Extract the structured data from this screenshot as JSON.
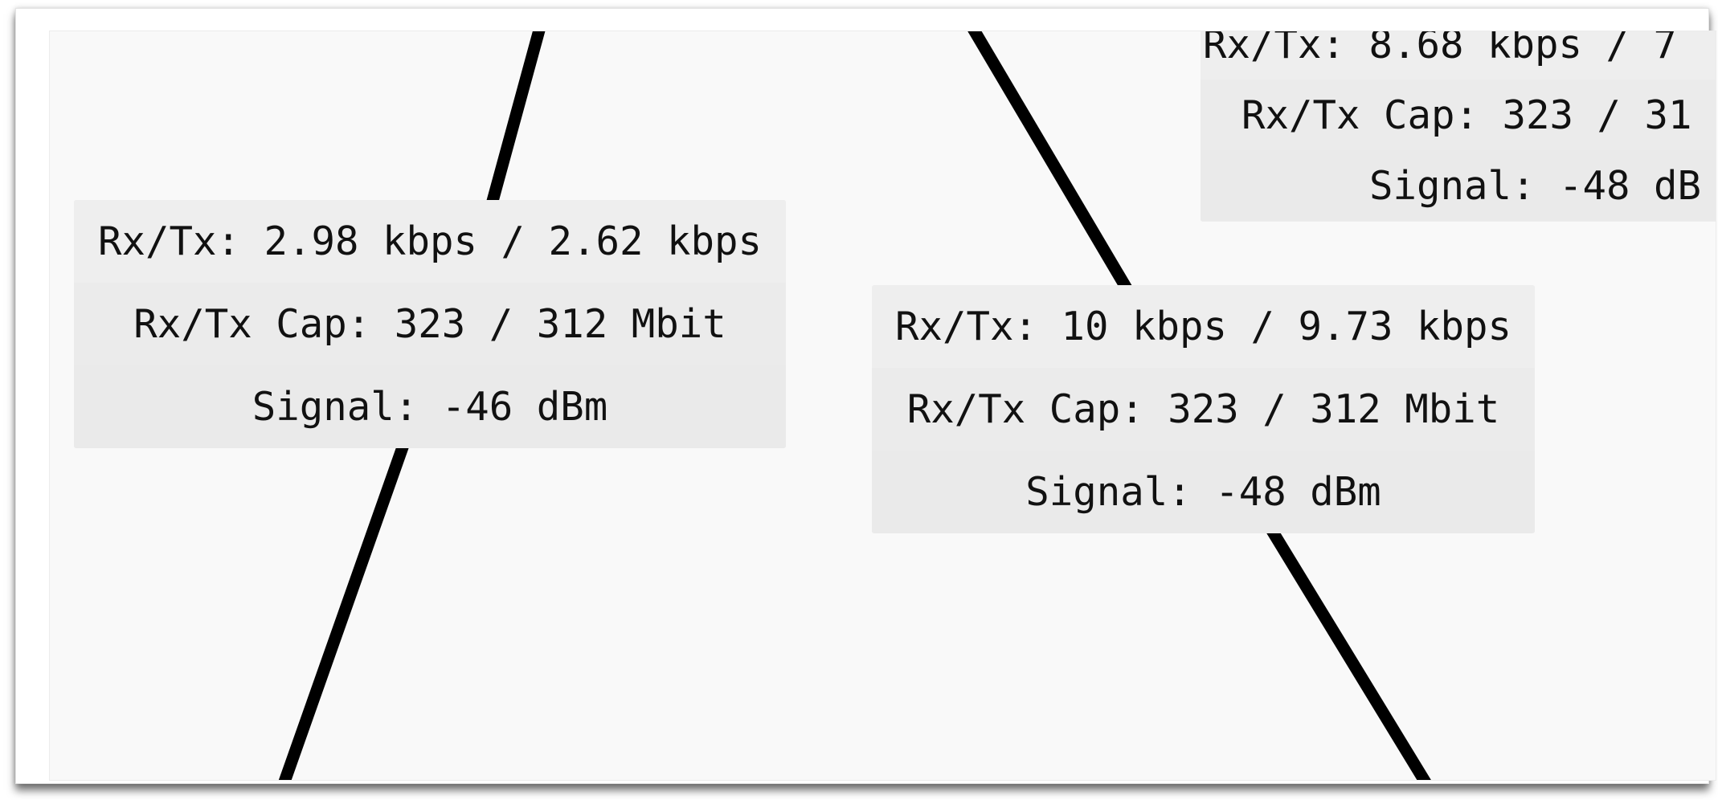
{
  "links": [
    {
      "id": "link-left",
      "rx_tx": "Rx/Tx: 2.98 kbps / 2.62 kbps",
      "rx_tx_cap": "Rx/Tx Cap: 323 / 312 Mbit",
      "signal": "Signal: -46 dBm"
    },
    {
      "id": "link-middle",
      "rx_tx": "Rx/Tx: 10 kbps / 9.73 kbps",
      "rx_tx_cap": "Rx/Tx Cap: 323 / 312 Mbit",
      "signal": "Signal: -48 dBm"
    },
    {
      "id": "link-top-right",
      "rx_tx": "Rx/Tx: 8.68 kbps / 7",
      "rx_tx_cap": "Rx/Tx Cap: 323 / 31",
      "signal": "Signal: -48 dB"
    }
  ],
  "colors": {
    "link_line": "#000000",
    "label_background": "#ededed",
    "canvas_background": "#f9f9f9",
    "text": "#111111"
  }
}
